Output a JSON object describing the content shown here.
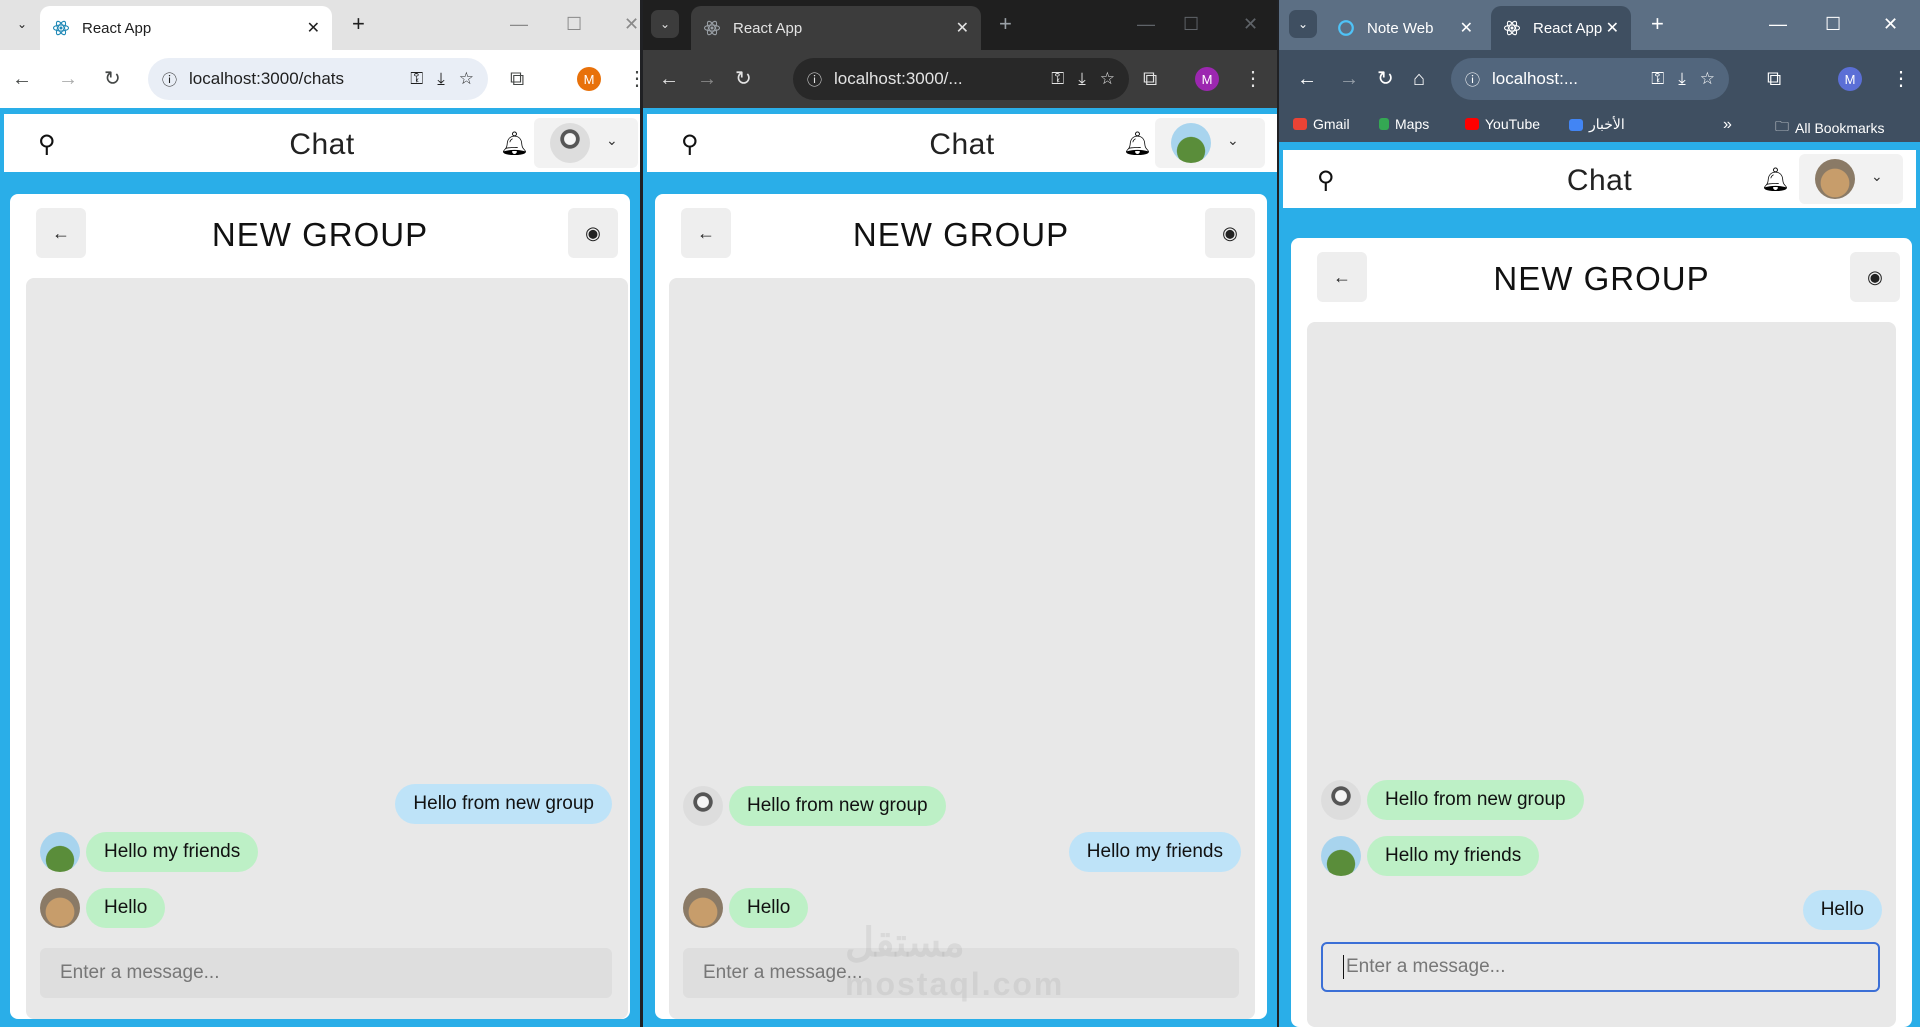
{
  "windows": [
    {
      "theme": "light",
      "tab_title": "React App",
      "url": "localhost:3000/chats",
      "profile_letter": "M",
      "profile_color": "#e8710a",
      "app": {
        "title": "Chat",
        "group_title": "NEW GROUP",
        "messages": [
          {
            "text": "Hello from new group",
            "side": "mine"
          },
          {
            "text": "Hello my friends",
            "side": "other"
          },
          {
            "text": "Hello",
            "side": "other"
          }
        ],
        "input_placeholder": "Enter a message..."
      }
    },
    {
      "theme": "dark",
      "tab_title": "React App",
      "url": "localhost:3000/...",
      "profile_letter": "M",
      "profile_color": "#9c27b0",
      "app": {
        "title": "Chat",
        "group_title": "NEW GROUP",
        "messages": [
          {
            "text": "Hello from new group",
            "side": "other"
          },
          {
            "text": "Hello my friends",
            "side": "mine"
          },
          {
            "text": "Hello",
            "side": "other"
          }
        ],
        "input_placeholder": "Enter a message..."
      }
    },
    {
      "theme": "bluegray",
      "tab_title_inactive": "Note Web",
      "tab_title": "React App",
      "url": "localhost:...",
      "profile_letter": "M",
      "profile_color": "#5b6fd6",
      "bookmarks": [
        "Gmail",
        "Maps",
        "YouTube",
        "الأخبار",
        "All Bookmarks"
      ],
      "app": {
        "title": "Chat",
        "group_title": "NEW GROUP",
        "messages": [
          {
            "text": "Hello from new group",
            "side": "other"
          },
          {
            "text": "Hello my friends",
            "side": "other"
          },
          {
            "text": "Hello",
            "side": "mine"
          }
        ],
        "input_placeholder": "Enter a message..."
      }
    }
  ],
  "watermark": {
    "arabic": "مستقل",
    "latin": "mostaql.com"
  },
  "icons": {
    "tab_search": "chevron-down-icon",
    "close": "close-icon",
    "new_tab": "plus-icon",
    "back": "arrow-left-icon",
    "forward": "arrow-right-icon",
    "reload": "reload-icon",
    "home": "home-icon",
    "search": "search-icon",
    "bell": "bell-icon",
    "eye": "eye-icon"
  }
}
